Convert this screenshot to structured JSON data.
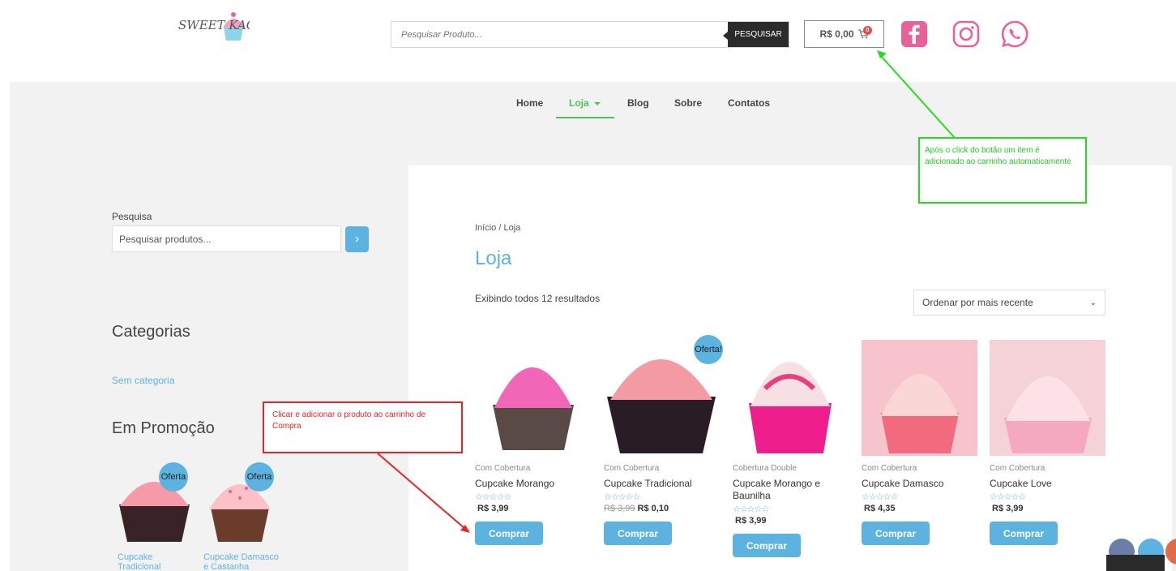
{
  "header": {
    "logo_text": "SWEET KACES",
    "search_placeholder": "Pesquisar Produto...",
    "search_button": "PESQUISAR",
    "cart_total": "R$ 0,00",
    "cart_count": "0"
  },
  "nav": {
    "items": [
      "Home",
      "Loja",
      "Blog",
      "Sobre",
      "Contatos"
    ]
  },
  "sidebar": {
    "search_label": "Pesquisa",
    "search_placeholder": "Pesquisar produtos...",
    "categories_title": "Categorias",
    "category_link": "Sem categoria",
    "promo_title": "Em Promoção",
    "promo_items": [
      {
        "name_line1": "Cupcake",
        "name_line2": "Tradicional",
        "badge": "Oferta"
      },
      {
        "name_line1": "Cupcake Damasco",
        "name_line2": "e Castanha",
        "badge": "Oferta"
      }
    ]
  },
  "shop": {
    "breadcrumb": "Início / Loja",
    "title": "Loja",
    "result_count": "Exibindo todos 12 resultados",
    "orderby": "Ordenar por mais recente",
    "buy_label": "Comprar",
    "products": [
      {
        "category": "Com Cobertura",
        "name": "Cupcake Morango",
        "old_price": "",
        "price": "R$ 3,99",
        "badge": ""
      },
      {
        "category": "Com Cobertura",
        "name": "Cupcake Tradicional",
        "old_price": "R$ 3,99",
        "price": "R$ 0,10",
        "badge": "Oferta!"
      },
      {
        "category": "Cobertura Double",
        "name": "Cupcake Morango e Baunilha",
        "old_price": "",
        "price": "R$ 3,99",
        "badge": ""
      },
      {
        "category": "Com Cobertura",
        "name": "Cupcake Damasco",
        "old_price": "",
        "price": "R$ 4,35",
        "badge": ""
      },
      {
        "category": "Com Cobertura",
        "name": "Cupcake Love",
        "old_price": "",
        "price": "R$ 3,99",
        "badge": ""
      }
    ]
  },
  "annotations": {
    "green_note": "Após o click do botão um item é adicionado ao carrinho automaticamente",
    "red_note": "Clicar e adicionar o produto ao carrinho de Compra"
  },
  "colors": {
    "accent": "#5db3e0",
    "brand_pink": "#e8629a",
    "nav_underline": "#4cc25a",
    "annotation_green": "#22dd22",
    "annotation_red": "#ee2222"
  }
}
